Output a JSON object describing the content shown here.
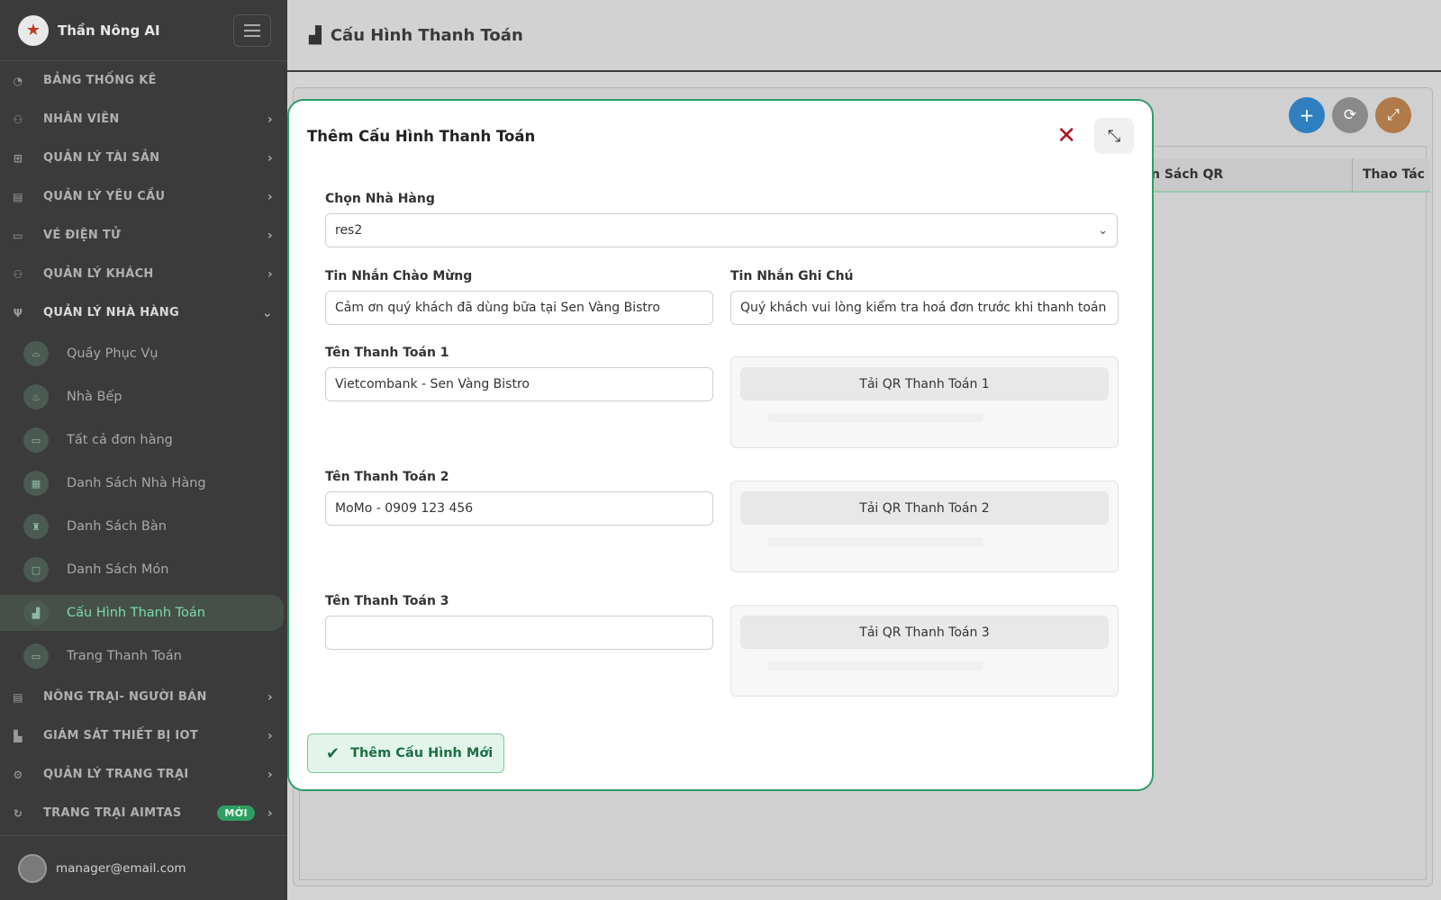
{
  "brand": {
    "name": "Thần Nông AI"
  },
  "sidebar": {
    "items": [
      {
        "label": "BẢNG THỐNG KÊ",
        "icon": "dashboard-icon",
        "chevron": false
      },
      {
        "label": "NHÂN VIÊN",
        "icon": "staff-icon",
        "chevron": true
      },
      {
        "label": "QUẢN LÝ TÀI SẢN",
        "icon": "assets-icon",
        "chevron": true
      },
      {
        "label": "QUẢN LÝ YÊU CẦU",
        "icon": "requests-icon",
        "chevron": true
      },
      {
        "label": "VÉ ĐIỆN TỬ",
        "icon": "ticket-icon",
        "chevron": true
      },
      {
        "label": "QUẢN LÝ KHÁCH",
        "icon": "guests-icon",
        "chevron": true
      },
      {
        "label": "QUẢN LÝ NHÀ HÀNG",
        "icon": "restaurant-icon",
        "chevron": true,
        "open": true
      }
    ],
    "subitems": [
      {
        "label": "Quầy Phục Vụ",
        "icon": "service-counter-icon"
      },
      {
        "label": "Nhà Bếp",
        "icon": "kitchen-icon"
      },
      {
        "label": "Tất cả đơn hàng",
        "icon": "orders-icon"
      },
      {
        "label": "Danh Sách Nhà Hàng",
        "icon": "restaurant-list-icon"
      },
      {
        "label": "Danh Sách Bàn",
        "icon": "table-list-icon"
      },
      {
        "label": "Danh Sách Món",
        "icon": "menu-list-icon"
      },
      {
        "label": "Cấu Hình Thanh Toán",
        "icon": "payment-config-icon",
        "active": true
      },
      {
        "label": "Trang Thanh Toán",
        "icon": "payment-page-icon"
      }
    ],
    "items_after": [
      {
        "label": "NÔNG TRẠI- NGƯỜI BÁN",
        "icon": "farm-seller-icon"
      },
      {
        "label": "GIÁM SÁT THIẾT BỊ IOT",
        "icon": "iot-icon"
      },
      {
        "label": "QUẢN LÝ TRANG TRẠI",
        "icon": "farm-icon"
      },
      {
        "label": "TRANG TRẠI AIMTAS",
        "icon": "aimtas-icon",
        "badge": "MỚI"
      }
    ],
    "user_email": "manager@email.com"
  },
  "header": {
    "title": "Cấu Hình Thanh Toán",
    "icon": "bar-chart-icon"
  },
  "table": {
    "col_qr": "n Sách QR",
    "col_actions": "Thao Tác"
  },
  "modal": {
    "title": "Thêm Cấu Hình Thanh Toán",
    "restaurant_label": "Chọn Nhà Hàng",
    "restaurant_value": "res2",
    "welcome_label": "Tin Nhắn Chào Mừng",
    "welcome_value": "Cảm ơn quý khách đã dùng bữa tại Sen Vàng Bistro",
    "note_label": "Tin Nhắn Ghi Chú",
    "note_value": "Quý khách vui lòng kiểm tra hoá đơn trước khi thanh toán",
    "payments": [
      {
        "label": "Tên Thanh Toán 1",
        "value": "Vietcombank - Sen Vàng Bistro",
        "qr_button": "Tải QR Thanh Toán 1"
      },
      {
        "label": "Tên Thanh Toán 2",
        "value": "MoMo - 0909 123 456",
        "qr_button": "Tải QR Thanh Toán 2"
      },
      {
        "label": "Tên Thanh Toán 3",
        "value": "",
        "qr_button": "Tải QR Thanh Toán 3"
      }
    ],
    "submit_label": "Thêm Cấu Hình Mới"
  },
  "colors": {
    "accent": "#2d9e6a",
    "close": "#b0101e",
    "sidebar_bg": "#3b3b3b",
    "add_fab": "#2f7ec0"
  }
}
